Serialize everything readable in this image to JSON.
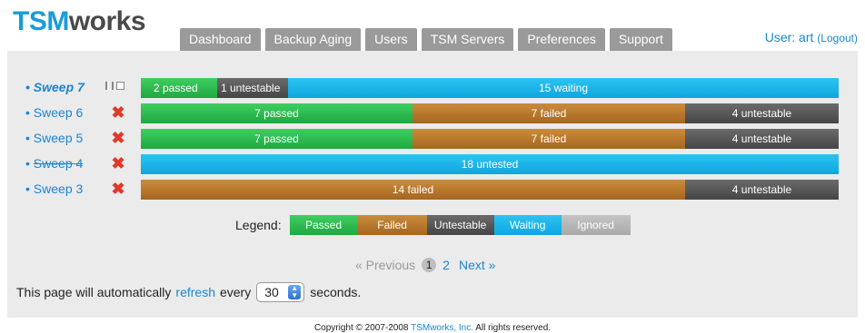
{
  "header": {
    "logo_tsm": "TSM",
    "logo_works": "works",
    "tabs": [
      "Dashboard",
      "Backup Aging",
      "Users",
      "TSM Servers",
      "Preferences",
      "Support"
    ],
    "user_label": "User: art",
    "logout_label": "(Logout)"
  },
  "sweeps": [
    {
      "label": "Sweep 7",
      "status": "running",
      "segments": [
        {
          "type": "passed",
          "count": 2,
          "text": "2 passed"
        },
        {
          "type": "untestable",
          "count": 1,
          "text": "1 untestable"
        },
        {
          "type": "waiting",
          "count": 15,
          "text": "15 waiting"
        }
      ]
    },
    {
      "label": "Sweep 6",
      "status": "error",
      "segments": [
        {
          "type": "passed",
          "count": 7,
          "text": "7 passed"
        },
        {
          "type": "failed",
          "count": 7,
          "text": "7 failed"
        },
        {
          "type": "untestable",
          "count": 4,
          "text": "4 untestable"
        }
      ]
    },
    {
      "label": "Sweep 5",
      "status": "error",
      "segments": [
        {
          "type": "passed",
          "count": 7,
          "text": "7 passed"
        },
        {
          "type": "failed",
          "count": 7,
          "text": "7 failed"
        },
        {
          "type": "untestable",
          "count": 4,
          "text": "4 untestable"
        }
      ]
    },
    {
      "label": "Sweep 4",
      "status": "error",
      "segments": [
        {
          "type": "waiting",
          "count": 18,
          "text": "18 untested"
        }
      ]
    },
    {
      "label": "Sweep 3",
      "status": "error",
      "segments": [
        {
          "type": "failed",
          "count": 14,
          "text": "14 failed"
        },
        {
          "type": "untestable",
          "count": 4,
          "text": "4 untestable"
        }
      ]
    }
  ],
  "legend": {
    "label": "Legend:",
    "items": [
      {
        "type": "passed",
        "text": "Passed"
      },
      {
        "type": "failed",
        "text": "Failed"
      },
      {
        "type": "untestable",
        "text": "Untestable"
      },
      {
        "type": "waiting",
        "text": "Waiting"
      },
      {
        "type": "ignored",
        "text": "Ignored"
      }
    ]
  },
  "pagination": {
    "previous": "« Previous",
    "current": "1",
    "page2": "2",
    "next": "Next »"
  },
  "refresh": {
    "prefix": "This page will automatically",
    "link": "refresh",
    "every": "every",
    "value": "30",
    "suffix": "seconds."
  },
  "footer": {
    "prefix": "Copyright © 2007-2008",
    "company": "TSMworks, Inc.",
    "suffix": "All rights reserved."
  },
  "colors": {
    "passed": "#2dbb50",
    "failed": "#b7772c",
    "untestable": "#555555",
    "waiting": "#17b2e8",
    "ignored": "#b5b5b5",
    "link": "#1b85d0",
    "error_x": "#e03a2b"
  }
}
